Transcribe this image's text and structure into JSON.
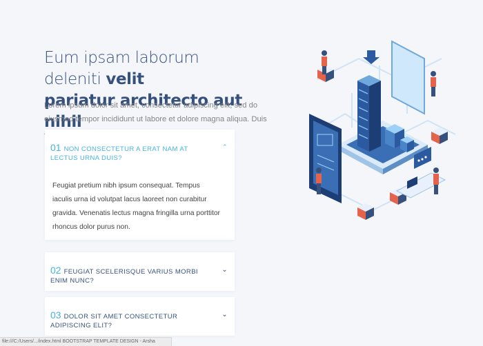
{
  "hero": {
    "title_light": "Eum ipsam laborum deleniti ",
    "title_bold_1": "velit",
    "title_bold_2": "pariatur architecto aut nihil",
    "lead": "Lorem ipsum dolor sit amet, consectetur adipiscing elit, sed do eiusmod tempor incididunt ut labore et dolore magna aliqua. Duis aute irure dolor in reprehenderit"
  },
  "faq": [
    {
      "num": "01",
      "question": "NON CONSECTETUR A ERAT NAM AT LECTUS URNA DUIS?",
      "answer": "Feugiat pretium nibh ipsum consequat. Tempus iaculis urna id volutpat lacus laoreet non curabitur gravida. Venenatis lectus magna fringilla urna porttitor rhoncus dolor purus non.",
      "open": true
    },
    {
      "num": "02",
      "question": "FEUGIAT SCELERISQUE VARIUS MORBI ENIM NUNC?",
      "open": false
    },
    {
      "num": "03",
      "question": "DOLOR SIT AMET CONSECTETUR ADIPISCING ELIT?",
      "open": false
    }
  ],
  "icons": {
    "open": "chevron-up-icon",
    "closed": "chevron-down-icon"
  },
  "statusbar": "file:///C:/Users/.../index.html  BOOTSTRAP TEMPLATE DESIGN - Arsha",
  "colors": {
    "accent": "#47b2e4",
    "navy": "#37517e",
    "bg": "#f4f6fa",
    "orange": "#e5634a"
  }
}
